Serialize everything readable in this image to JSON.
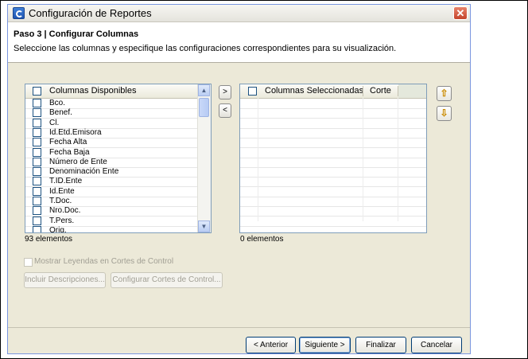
{
  "window": {
    "title": "Configuración de Reportes"
  },
  "header": {
    "step_title": "Paso 3 | Configurar Columnas",
    "description": "Seleccione las columnas y especifique las configuraciones correspondientes para su visualización."
  },
  "available": {
    "header": "Columnas Disponibles",
    "items": [
      "Bco.",
      "Benef.",
      "Cl.",
      "Id.Etd.Emisora",
      "Fecha Alta",
      "Fecha Baja",
      "Número de Ente",
      "Denominación Ente",
      "T.ID.Ente",
      "Id.Ente",
      "T.Doc.",
      "Nro.Doc.",
      "T.Pers.",
      "Orig."
    ],
    "count": "93 elementos"
  },
  "transfer": {
    "add": ">",
    "remove": "<"
  },
  "selected": {
    "header_name": "Columnas Seleccionadas",
    "header_cut": "Corte",
    "count": "0 elementos"
  },
  "options": {
    "show_legends": "Mostrar Leyendas en Cortes de Control",
    "include_descriptions": "Incluir Descripciones...",
    "configure_cuts": "Configurar Cortes de Control..."
  },
  "footer": {
    "back": "< Anterior",
    "next": "Siguiente >",
    "finish": "Finalizar",
    "cancel": "Cancelar"
  },
  "icons": {
    "move_up": "arrow-up-icon",
    "move_down": "arrow-down-icon"
  }
}
